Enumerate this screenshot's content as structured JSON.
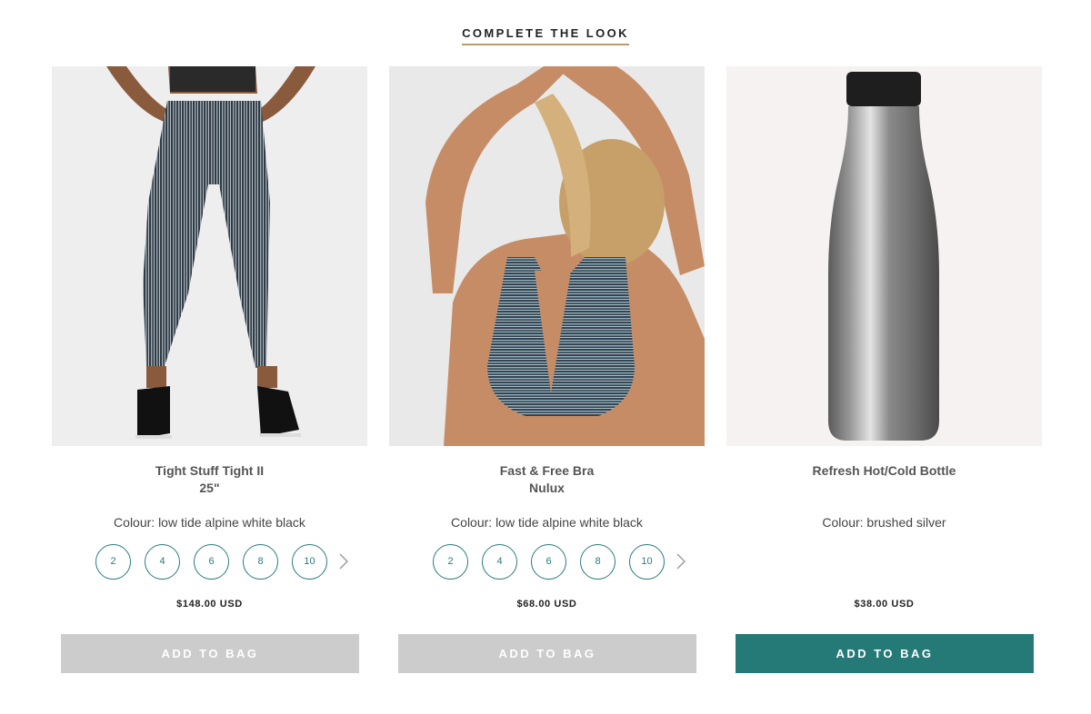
{
  "section": {
    "title": "COMPLETE THE LOOK"
  },
  "products": [
    {
      "name_line1": "Tight Stuff Tight II",
      "name_line2": "25\"",
      "colour": "Colour: low tide alpine white black",
      "sizes": [
        "2",
        "4",
        "6",
        "8",
        "10"
      ],
      "price": "$148.00 USD",
      "button": "ADD TO BAG",
      "image_icon": "leggings-photo"
    },
    {
      "name_line1": "Fast & Free Bra",
      "name_line2": "Nulux",
      "colour": "Colour: low tide alpine white black",
      "sizes": [
        "2",
        "4",
        "6",
        "8",
        "10"
      ],
      "price": "$68.00 USD",
      "button": "ADD TO BAG",
      "image_icon": "sports-bra-photo"
    },
    {
      "name_line1": "Refresh Hot/Cold Bottle",
      "name_line2": "",
      "colour": "Colour: brushed silver",
      "sizes": [],
      "price": "$38.00 USD",
      "button": "ADD TO BAG",
      "image_icon": "water-bottle-photo"
    }
  ],
  "colors": {
    "accent": "#257a78",
    "underline": "#b79c72",
    "disabled": "#cccccc"
  }
}
